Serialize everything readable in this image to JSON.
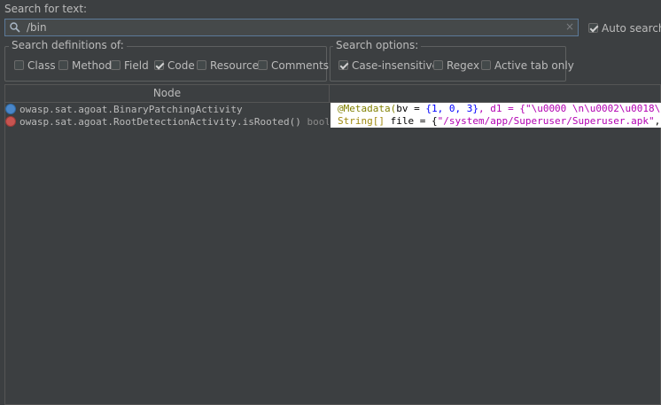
{
  "search": {
    "label": "Search for text:",
    "value": "/bin",
    "clear": "×"
  },
  "auto_search": {
    "label": "Auto search",
    "checked": true
  },
  "definitions": {
    "title": "Search definitions of:",
    "items": [
      {
        "label": "Class",
        "checked": false
      },
      {
        "label": "Method",
        "checked": false
      },
      {
        "label": "Field",
        "checked": false
      },
      {
        "label": "Code",
        "checked": true
      },
      {
        "label": "Resource",
        "checked": false
      },
      {
        "label": "Comments",
        "checked": false
      }
    ]
  },
  "options": {
    "title": "Search options:",
    "items": [
      {
        "label": "Case-insensitive",
        "checked": true
      },
      {
        "label": "Regex",
        "checked": false
      },
      {
        "label": "Active tab only",
        "checked": false
      }
    ]
  },
  "table": {
    "header_node": "Node",
    "rows": [
      {
        "node": "owasp.sat.agoat.BinaryPatchingActivity",
        "type": "",
        "icon": "class-icon"
      },
      {
        "node": "owasp.sat.agoat.RootDetectionActivity.isRooted()",
        "type": "boolean",
        "icon": "method-icon"
      }
    ]
  },
  "code_lines": [
    {
      "a": "@Metadata(",
      "b": "bv = ",
      "c": "{1, 0, 3}",
      "d": ", d1 = {\"\\u0000 \\n\\u0002\\u0018\\u0"
    },
    {
      "a": "String[]",
      "b": " file = {",
      "c": "\"/system/app/Superuser/Superuser.apk\"",
      "d": ", \""
    }
  ]
}
